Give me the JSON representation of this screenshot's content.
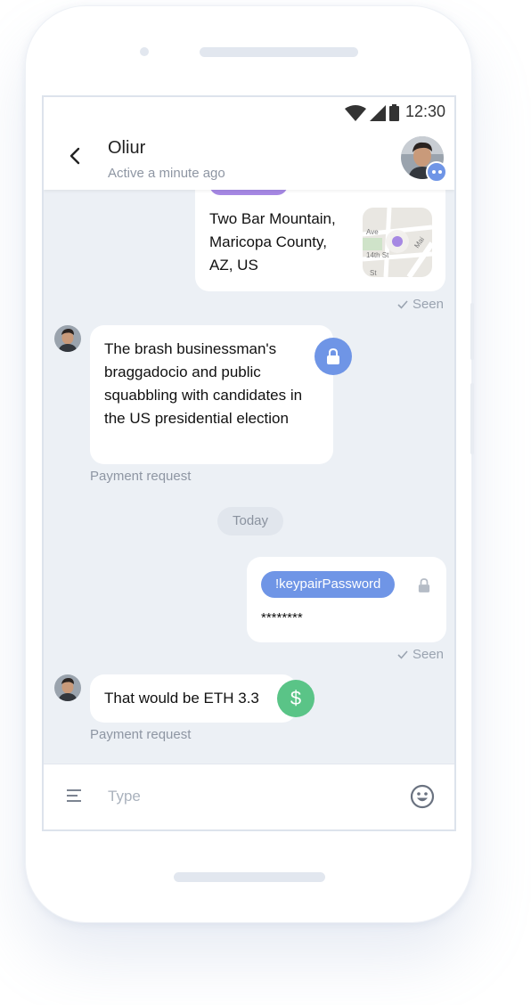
{
  "status_bar": {
    "time": "12:30"
  },
  "header": {
    "name": "Oliur",
    "status": "Active a minute ago"
  },
  "messages": {
    "location": {
      "text": "Two Bar Mountain, Maricopa County, AZ, US",
      "map_labels": [
        "Ave",
        "14th St",
        "Mai",
        "St"
      ]
    },
    "seen_1": "Seen",
    "incoming_1": {
      "text": "The brash businessman's braggadocio and public squabbling with candidates in the US presidential election",
      "caption": "Payment request"
    },
    "date_divider": "Today",
    "password": {
      "chip": "!keypairPassword",
      "masked": "********"
    },
    "seen_2": "Seen",
    "incoming_2": {
      "text": "That would be ETH 3.3",
      "badge": "$",
      "caption": "Payment request"
    }
  },
  "composer": {
    "placeholder": "Type"
  },
  "colors": {
    "accent_blue": "#6f95e6",
    "accent_purple": "#a688e3",
    "accent_green": "#5ac487",
    "background": "#ecf0f5"
  },
  "icons": [
    "wifi-icon",
    "signal-icon",
    "battery-icon",
    "back-arrow-icon",
    "lock-icon",
    "dollar-icon",
    "menu-icon",
    "emoji-icon",
    "check-icon"
  ]
}
